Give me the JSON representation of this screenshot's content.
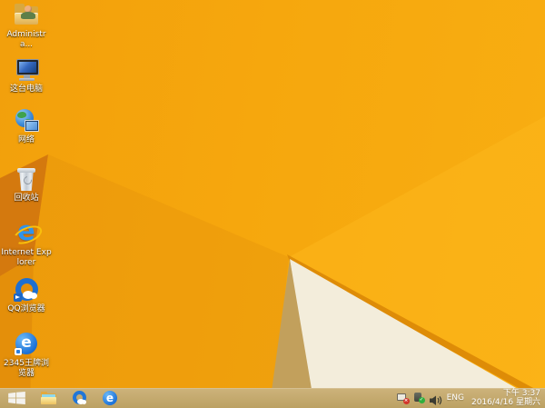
{
  "desktop": {
    "icons": [
      {
        "name": "administrator-folder",
        "label": "Administra..."
      },
      {
        "name": "this-pc",
        "label": "这台电脑"
      },
      {
        "name": "network",
        "label": "网络"
      },
      {
        "name": "recycle-bin",
        "label": "回收站"
      },
      {
        "name": "internet-explorer",
        "label": "Internet Explorer"
      },
      {
        "name": "qq-browser",
        "label": "QQ浏览器"
      },
      {
        "name": "ace-browser-2345",
        "label": "2345王牌浏览器"
      }
    ],
    "browser_e_glyph": "e"
  },
  "taskbar": {
    "buttons": [
      "start",
      "file-explorer",
      "qq-browser",
      "2345-browser"
    ],
    "tray": {
      "icons": [
        "network-status",
        "security-check",
        "volume"
      ],
      "language": "ENG",
      "time": "下午 3:37",
      "date": "2016/4/16 星期六"
    }
  },
  "colors": {
    "wallpaper_base_left": "#F2A00C",
    "wallpaper_base": "#F6A70D",
    "wallpaper_base_right": "#F8AE12",
    "wallpaper_dark_facet": "#D4790E",
    "wallpaper_mid_facet": "#E08C0A",
    "wallpaper_bright_facet": "#FDB81C",
    "wallpaper_gold_edge": "#DE8C07",
    "wallpaper_cream": "#F3EDDB",
    "wallpaper_tan": "#C2A05C",
    "taskbar_bg_top": "#CDB37B",
    "taskbar_bg": "#BCA163"
  }
}
